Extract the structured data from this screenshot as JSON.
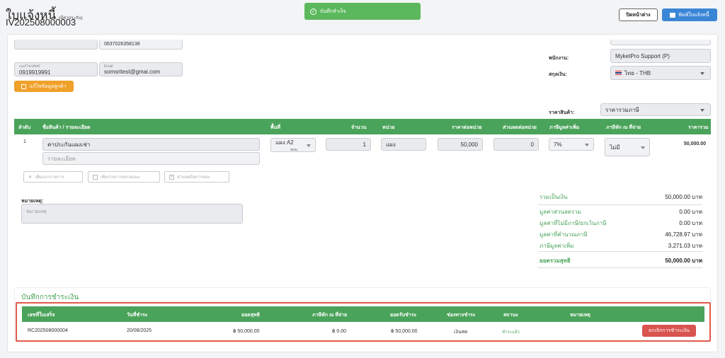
{
  "header": {
    "title": "ใบแจ้งหนี้",
    "title_badge": "(มีค่าประกัน)",
    "doc_number": "IV202508000003",
    "close_label": "ปิดหน้าต่าง",
    "print_label": "พิมพ์ใบแจ้งหนี้"
  },
  "toast": {
    "message": "บันทึกสำเร็จ"
  },
  "customer": {
    "cut_field_value": "0637026358138",
    "phone_label": "เบอร์โทรศัพท์",
    "phone_value": "0919919991",
    "email_label": "Email",
    "email_value": "somsritest@gmai.com",
    "edit_button": "แก้ไขข้อมูลลูกค้า"
  },
  "right_info": {
    "staff_label": "พนักงาน:",
    "staff_value": "MyketPro Support (P)",
    "currency_label": "สกุลเงิน:",
    "currency_value": "ไทย - THB",
    "price_type_label": "ราคาสินค้า:",
    "price_type_value": "ราคารวมภาษี"
  },
  "items_table": {
    "headers": [
      "ลำดับ",
      "ชื่อสินค้า / รายละเอียด",
      "พื้นที่",
      "จำนวน",
      "หน่วย",
      "ราคาต่อหน่วย",
      "ส่วนลดต่อหน่วย",
      "ภาษีมูลค่าเพิ่ม",
      "ภาษีหัก ณ ที่จ่าย",
      "ราคารวม"
    ],
    "rows": [
      {
        "index": "1",
        "name": "ค่าประกันแผงเช่า",
        "detail_placeholder": "รายละเอียด",
        "area": "แผง A2",
        "area_sub": "-ตรม",
        "qty": "1",
        "unit": "แผง",
        "unit_price": "50,000",
        "discount": "0",
        "vat": "7%",
        "wht": "ไม่มี",
        "total": "50,000.00"
      }
    ],
    "add_item": "เพิ่มแถวรายการ",
    "add_multi": "เพิ่มรายการหลายแผง",
    "discount_btn": "ส่วนลดบิลการจอง"
  },
  "note": {
    "label": "หมายเหตุ:",
    "placeholder": "หมายเหตุ"
  },
  "summary": [
    {
      "label": "รวมเป็นเงิน",
      "value": "50,000.00 บาท"
    },
    {
      "label": "มูลค่าส่วนลดรวม",
      "value": "0.00 บาท"
    },
    {
      "label": "มูลค่าที่ไม่มีภาษี/ยกเว้นภาษี",
      "value": "0.00 บาท"
    },
    {
      "label": "มูลค่าที่คำนวณภาษี",
      "value": "46,728.97 บาท"
    },
    {
      "label": "ภาษีมูลค่าเพิ่ม",
      "value": "3,271.03 บาท"
    }
  ],
  "net_total": {
    "label": "ยอดรวมสุทธิ",
    "value": "50,000.00 บาท"
  },
  "payments": {
    "section_title": "บันทึกการชำระเงิน",
    "headers": [
      "เลขที่ใบเสร็จ",
      "วันที่ชำระ",
      "ยอดสุทธิ",
      "ภาษีหัก ณ ที่จ่าย",
      "ยอดรับชำระ",
      "ช่องทางชำระ",
      "สถานะ",
      "หมายเหตุ"
    ],
    "rows": [
      {
        "receipt": "RC202508000004",
        "date": "20/08/2025",
        "net": "฿ 50,000.00",
        "wht": "฿ 0.00",
        "received": "฿ 50,000.00",
        "channel": "เงินสด",
        "status": "ชำระแล้ว",
        "note": "",
        "cancel_label": "ยกเลิกการชำระเงิน"
      }
    ]
  },
  "colors": {
    "green": "#4aa35a",
    "blue": "#3a86d6",
    "orange": "#f0a12a",
    "red": "#d9534f",
    "toast": "#5cb85c"
  }
}
